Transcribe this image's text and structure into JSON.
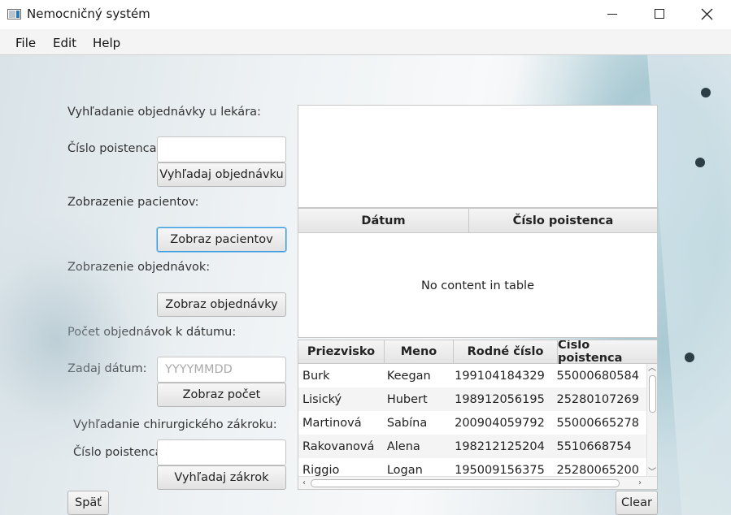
{
  "window": {
    "title": "Nemocničný systém"
  },
  "menu": {
    "file": "File",
    "edit": "Edit",
    "help": "Help"
  },
  "form": {
    "search_order_heading": "Vyhľadanie objednávky u lekára:",
    "insurance_label_1": "Číslo poistenca:",
    "insurance_value_1": "",
    "search_order_button": "Vyhľadaj objednávku",
    "show_patients_heading": "Zobrazenie pacientov:",
    "show_patients_button": "Zobraz pacientov",
    "show_orders_heading": "Zobrazenie objednávok:",
    "show_orders_button": "Zobraz objednávky",
    "count_orders_heading": "Počet objednávok k dátumu:",
    "date_label": "Zadaj dátum:",
    "date_placeholder": "YYYYMMDD",
    "date_value": "",
    "count_button": "Zobraz počet",
    "surgery_heading": "Vyhľadanie chirurgického zákroku:",
    "insurance_label_2": "Číslo poistenca:",
    "insurance_value_2": "",
    "search_surgery_button": "Vyhľadaj zákrok",
    "back_button": "Späť",
    "clear_button": "Clear"
  },
  "output_text": "",
  "orders_table": {
    "columns": [
      "Dátum",
      "Číslo poistenca"
    ],
    "empty_message": "No content in table"
  },
  "patients_table": {
    "columns": [
      "Priezvisko",
      "Meno",
      "Rodné číslo",
      "Číslo poistenca"
    ],
    "rows": [
      {
        "surname": "Burk",
        "name": "Keegan",
        "birth_number": "199104184329",
        "insurance": "55000680584"
      },
      {
        "surname": "Lisický",
        "name": "Hubert",
        "birth_number": "198912056195",
        "insurance": "25280107269"
      },
      {
        "surname": "Martinová",
        "name": "Sabína",
        "birth_number": "200904059792",
        "insurance": "55000665278"
      },
      {
        "surname": "Rakovanová",
        "name": "Alena",
        "birth_number": "198212125204",
        "insurance": "5510668754"
      },
      {
        "surname": "Riggio",
        "name": "Logan",
        "birth_number": "195009156375",
        "insurance": "25280065200"
      }
    ]
  },
  "icons": {
    "app": "app-window-icon",
    "minimize": "minimize-icon",
    "maximize": "maximize-icon",
    "close": "close-icon"
  }
}
